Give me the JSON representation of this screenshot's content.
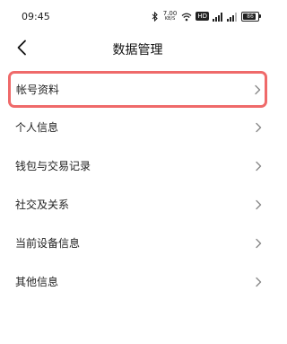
{
  "status_bar": {
    "time": "09:45",
    "net_speed_value": "7.00",
    "net_speed_unit": "KB/S",
    "hd_badge": "HD",
    "battery": "86",
    "battery_level": 0.86
  },
  "header": {
    "title": "数据管理"
  },
  "highlight_color": "#ef6a6a",
  "menu": {
    "items": [
      {
        "label": "帐号资料"
      },
      {
        "label": "个人信息"
      },
      {
        "label": "钱包与交易记录"
      },
      {
        "label": "社交及关系"
      },
      {
        "label": "当前设备信息"
      },
      {
        "label": "其他信息"
      }
    ]
  }
}
